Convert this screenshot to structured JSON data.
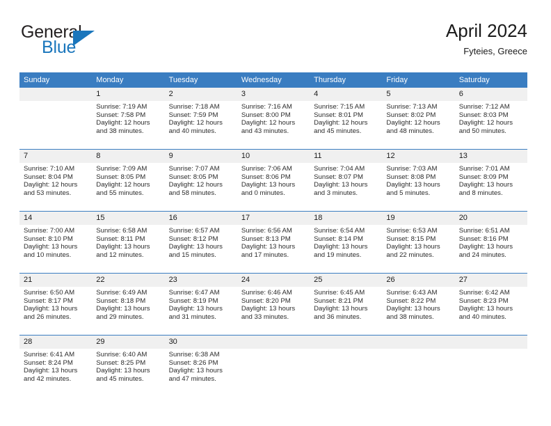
{
  "brand": {
    "name_part1": "General",
    "name_part2": "Blue",
    "logo_icon": "triangle-icon",
    "colors": {
      "blue": "#1a76bc",
      "dark": "#231f20"
    }
  },
  "header": {
    "title": "April 2024",
    "subtitle": "Fyteies, Greece"
  },
  "theme": {
    "header_row_bg": "#3a7dc1",
    "daynum_bg": "#f0f0f0",
    "separator": "#3a7dc1"
  },
  "calendar": {
    "weekday_headers": [
      "Sunday",
      "Monday",
      "Tuesday",
      "Wednesday",
      "Thursday",
      "Friday",
      "Saturday"
    ],
    "weeks": [
      [
        {
          "day": "",
          "empty": true,
          "sunrise": "",
          "sunset": "",
          "daylight1": "",
          "daylight2": ""
        },
        {
          "day": "1",
          "sunrise": "Sunrise: 7:19 AM",
          "sunset": "Sunset: 7:58 PM",
          "daylight1": "Daylight: 12 hours",
          "daylight2": "and 38 minutes."
        },
        {
          "day": "2",
          "sunrise": "Sunrise: 7:18 AM",
          "sunset": "Sunset: 7:59 PM",
          "daylight1": "Daylight: 12 hours",
          "daylight2": "and 40 minutes."
        },
        {
          "day": "3",
          "sunrise": "Sunrise: 7:16 AM",
          "sunset": "Sunset: 8:00 PM",
          "daylight1": "Daylight: 12 hours",
          "daylight2": "and 43 minutes."
        },
        {
          "day": "4",
          "sunrise": "Sunrise: 7:15 AM",
          "sunset": "Sunset: 8:01 PM",
          "daylight1": "Daylight: 12 hours",
          "daylight2": "and 45 minutes."
        },
        {
          "day": "5",
          "sunrise": "Sunrise: 7:13 AM",
          "sunset": "Sunset: 8:02 PM",
          "daylight1": "Daylight: 12 hours",
          "daylight2": "and 48 minutes."
        },
        {
          "day": "6",
          "sunrise": "Sunrise: 7:12 AM",
          "sunset": "Sunset: 8:03 PM",
          "daylight1": "Daylight: 12 hours",
          "daylight2": "and 50 minutes."
        }
      ],
      [
        {
          "day": "7",
          "sunrise": "Sunrise: 7:10 AM",
          "sunset": "Sunset: 8:04 PM",
          "daylight1": "Daylight: 12 hours",
          "daylight2": "and 53 minutes."
        },
        {
          "day": "8",
          "sunrise": "Sunrise: 7:09 AM",
          "sunset": "Sunset: 8:05 PM",
          "daylight1": "Daylight: 12 hours",
          "daylight2": "and 55 minutes."
        },
        {
          "day": "9",
          "sunrise": "Sunrise: 7:07 AM",
          "sunset": "Sunset: 8:05 PM",
          "daylight1": "Daylight: 12 hours",
          "daylight2": "and 58 minutes."
        },
        {
          "day": "10",
          "sunrise": "Sunrise: 7:06 AM",
          "sunset": "Sunset: 8:06 PM",
          "daylight1": "Daylight: 13 hours",
          "daylight2": "and 0 minutes."
        },
        {
          "day": "11",
          "sunrise": "Sunrise: 7:04 AM",
          "sunset": "Sunset: 8:07 PM",
          "daylight1": "Daylight: 13 hours",
          "daylight2": "and 3 minutes."
        },
        {
          "day": "12",
          "sunrise": "Sunrise: 7:03 AM",
          "sunset": "Sunset: 8:08 PM",
          "daylight1": "Daylight: 13 hours",
          "daylight2": "and 5 minutes."
        },
        {
          "day": "13",
          "sunrise": "Sunrise: 7:01 AM",
          "sunset": "Sunset: 8:09 PM",
          "daylight1": "Daylight: 13 hours",
          "daylight2": "and 8 minutes."
        }
      ],
      [
        {
          "day": "14",
          "sunrise": "Sunrise: 7:00 AM",
          "sunset": "Sunset: 8:10 PM",
          "daylight1": "Daylight: 13 hours",
          "daylight2": "and 10 minutes."
        },
        {
          "day": "15",
          "sunrise": "Sunrise: 6:58 AM",
          "sunset": "Sunset: 8:11 PM",
          "daylight1": "Daylight: 13 hours",
          "daylight2": "and 12 minutes."
        },
        {
          "day": "16",
          "sunrise": "Sunrise: 6:57 AM",
          "sunset": "Sunset: 8:12 PM",
          "daylight1": "Daylight: 13 hours",
          "daylight2": "and 15 minutes."
        },
        {
          "day": "17",
          "sunrise": "Sunrise: 6:56 AM",
          "sunset": "Sunset: 8:13 PM",
          "daylight1": "Daylight: 13 hours",
          "daylight2": "and 17 minutes."
        },
        {
          "day": "18",
          "sunrise": "Sunrise: 6:54 AM",
          "sunset": "Sunset: 8:14 PM",
          "daylight1": "Daylight: 13 hours",
          "daylight2": "and 19 minutes."
        },
        {
          "day": "19",
          "sunrise": "Sunrise: 6:53 AM",
          "sunset": "Sunset: 8:15 PM",
          "daylight1": "Daylight: 13 hours",
          "daylight2": "and 22 minutes."
        },
        {
          "day": "20",
          "sunrise": "Sunrise: 6:51 AM",
          "sunset": "Sunset: 8:16 PM",
          "daylight1": "Daylight: 13 hours",
          "daylight2": "and 24 minutes."
        }
      ],
      [
        {
          "day": "21",
          "sunrise": "Sunrise: 6:50 AM",
          "sunset": "Sunset: 8:17 PM",
          "daylight1": "Daylight: 13 hours",
          "daylight2": "and 26 minutes."
        },
        {
          "day": "22",
          "sunrise": "Sunrise: 6:49 AM",
          "sunset": "Sunset: 8:18 PM",
          "daylight1": "Daylight: 13 hours",
          "daylight2": "and 29 minutes."
        },
        {
          "day": "23",
          "sunrise": "Sunrise: 6:47 AM",
          "sunset": "Sunset: 8:19 PM",
          "daylight1": "Daylight: 13 hours",
          "daylight2": "and 31 minutes."
        },
        {
          "day": "24",
          "sunrise": "Sunrise: 6:46 AM",
          "sunset": "Sunset: 8:20 PM",
          "daylight1": "Daylight: 13 hours",
          "daylight2": "and 33 minutes."
        },
        {
          "day": "25",
          "sunrise": "Sunrise: 6:45 AM",
          "sunset": "Sunset: 8:21 PM",
          "daylight1": "Daylight: 13 hours",
          "daylight2": "and 36 minutes."
        },
        {
          "day": "26",
          "sunrise": "Sunrise: 6:43 AM",
          "sunset": "Sunset: 8:22 PM",
          "daylight1": "Daylight: 13 hours",
          "daylight2": "and 38 minutes."
        },
        {
          "day": "27",
          "sunrise": "Sunrise: 6:42 AM",
          "sunset": "Sunset: 8:23 PM",
          "daylight1": "Daylight: 13 hours",
          "daylight2": "and 40 minutes."
        }
      ],
      [
        {
          "day": "28",
          "sunrise": "Sunrise: 6:41 AM",
          "sunset": "Sunset: 8:24 PM",
          "daylight1": "Daylight: 13 hours",
          "daylight2": "and 42 minutes."
        },
        {
          "day": "29",
          "sunrise": "Sunrise: 6:40 AM",
          "sunset": "Sunset: 8:25 PM",
          "daylight1": "Daylight: 13 hours",
          "daylight2": "and 45 minutes."
        },
        {
          "day": "30",
          "sunrise": "Sunrise: 6:38 AM",
          "sunset": "Sunset: 8:26 PM",
          "daylight1": "Daylight: 13 hours",
          "daylight2": "and 47 minutes."
        },
        {
          "day": "",
          "empty": true,
          "sunrise": "",
          "sunset": "",
          "daylight1": "",
          "daylight2": ""
        },
        {
          "day": "",
          "empty": true,
          "sunrise": "",
          "sunset": "",
          "daylight1": "",
          "daylight2": ""
        },
        {
          "day": "",
          "empty": true,
          "sunrise": "",
          "sunset": "",
          "daylight1": "",
          "daylight2": ""
        },
        {
          "day": "",
          "empty": true,
          "sunrise": "",
          "sunset": "",
          "daylight1": "",
          "daylight2": ""
        }
      ]
    ]
  }
}
